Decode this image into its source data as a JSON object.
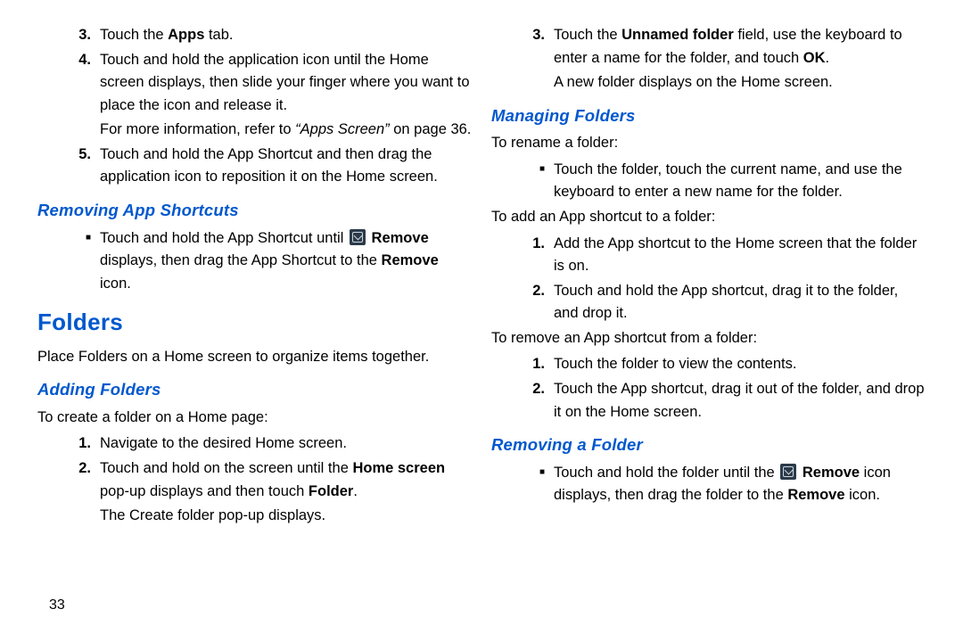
{
  "pagenum": "33",
  "left": {
    "steps": [
      {
        "n": "3.",
        "pre": "Touch the ",
        "b1": "Apps",
        "post": " tab."
      },
      {
        "n": "4.",
        "text": "Touch and hold the application icon until the Home screen displays, then slide your finger where you want to place the icon and release it."
      },
      {
        "sub_pre": "For more information, refer to ",
        "sub_i": "“Apps Screen”",
        "sub_post": " on page 36."
      },
      {
        "n": "5.",
        "text": "Touch and hold the App Shortcut and then drag the application icon to reposition it on the Home screen."
      }
    ],
    "h2a": "Removing App Shortcuts",
    "rem_pre": "Touch and hold the App Shortcut until ",
    "rem_b1": "Remove",
    "rem_mid": " displays, then drag the App Shortcut to the ",
    "rem_b2": "Remove",
    "rem_post": " icon.",
    "h1": "Folders",
    "folders_intro": "Place Folders on a Home screen to organize items together.",
    "h2b": "Adding Folders",
    "add_intro": "To create a folder on a Home page:",
    "add_steps": [
      {
        "n": "1.",
        "text": "Navigate to the desired Home screen."
      },
      {
        "n": "2.",
        "pre": "Touch and hold on the screen until the ",
        "b1": "Home screen",
        "mid": " pop-up displays and then touch ",
        "b2": "Folder",
        "post": "."
      },
      {
        "sub": "The Create folder pop-up displays."
      }
    ]
  },
  "right": {
    "step3_n": "3.",
    "step3_pre": "Touch the ",
    "step3_b1": "Unnamed folder",
    "step3_mid": " field, use the keyboard to enter a name for the folder, and touch ",
    "step3_b2": "OK",
    "step3_post": ".",
    "step3_sub": "A new folder displays on the Home screen.",
    "h2a": "Managing Folders",
    "rename_intro": "To rename a folder:",
    "rename_bullet": "Touch the folder, touch the current name, and use the keyboard to enter a new name for the folder.",
    "addshort_intro": "To add an App shortcut to a folder:",
    "addshort_steps": [
      {
        "n": "1.",
        "text": "Add the App shortcut to the Home screen that the folder is on."
      },
      {
        "n": "2.",
        "text": "Touch and hold the App shortcut, drag it to the folder, and drop it."
      }
    ],
    "remshort_intro": "To remove an App shortcut from a folder:",
    "remshort_steps": [
      {
        "n": "1.",
        "text": "Touch the folder to view the contents."
      },
      {
        "n": "2.",
        "text": "Touch the App shortcut, drag it out of the folder, and drop it on the Home screen."
      }
    ],
    "h2b": "Removing a Folder",
    "remfold_pre": "Touch and hold the folder until the ",
    "remfold_b1": "Remove",
    "remfold_mid": " icon displays, then drag the folder to the ",
    "remfold_b2": "Remove",
    "remfold_post": " icon."
  }
}
